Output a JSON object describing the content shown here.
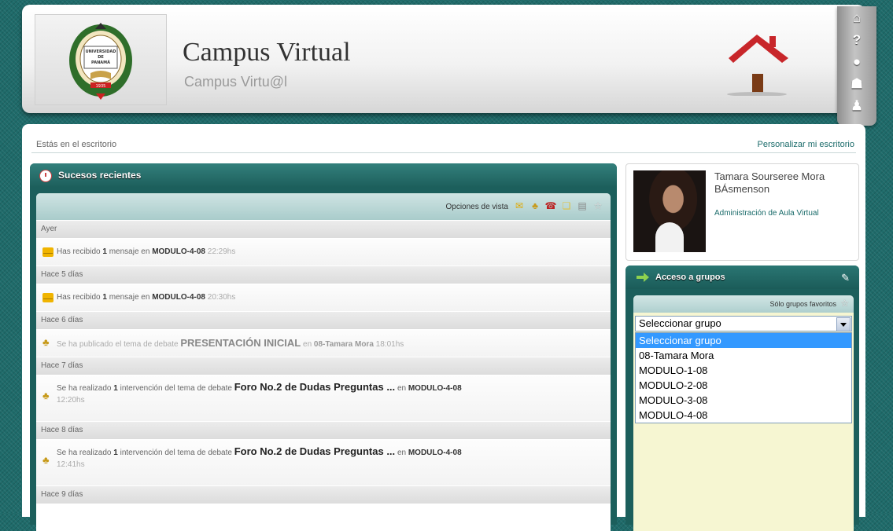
{
  "header": {
    "title": "Campus Virtual",
    "subtitle": "Campus Virtu@l",
    "logo_text": [
      "UNIVERSIDAD",
      "DE",
      "PANAMÁ",
      "1935"
    ]
  },
  "toolbar": {
    "icons": [
      "home-icon",
      "help-icon",
      "search-icon",
      "user-icon",
      "people-icon"
    ]
  },
  "breadcrumb": "Estás en el escritorio",
  "personalize_link": "Personalizar mi escritorio",
  "events": {
    "title": "Sucesos recientes",
    "view_options_label": "Opciones de vista",
    "days": [
      {
        "label": "Ayer",
        "items": [
          {
            "type": "message",
            "pre": "Has recibido",
            "count": "1",
            "mid": "mensaje en",
            "course": "MODULO-4-08",
            "time": "22:29hs"
          }
        ]
      },
      {
        "label": "Hace 5 días",
        "items": [
          {
            "type": "message",
            "pre": "Has recibido",
            "count": "1",
            "mid": "mensaje en",
            "course": "MODULO-4-08",
            "time": "20:30hs"
          }
        ]
      },
      {
        "label": "Hace 6 días",
        "items": [
          {
            "type": "forum",
            "pre": "Se ha publicado el tema de debate",
            "topic": "PRESENTACIÓN INICIAL",
            "mid": "en",
            "course": "08-Tamara Mora",
            "time": "18:01hs"
          }
        ]
      },
      {
        "label": "Hace 7 días",
        "items": [
          {
            "type": "forum",
            "pre": "Se ha realizado",
            "count": "1",
            "mid": "intervención del tema de debate",
            "topic": "Foro No.2 de Dudas Preguntas ...",
            "mid2": "en",
            "course": "MODULO-4-08",
            "time": "12:20hs"
          }
        ]
      },
      {
        "label": "Hace 8 días",
        "items": [
          {
            "type": "forum",
            "pre": "Se ha realizado",
            "count": "1",
            "mid": "intervención del tema de debate",
            "topic": "Foro No.2 de Dudas Preguntas ...",
            "mid2": "en",
            "course": "MODULO-4-08",
            "time": "12:41hs"
          }
        ]
      },
      {
        "label": "Hace 9 días",
        "items": []
      }
    ]
  },
  "profile": {
    "name": "Tamara Sourseree Mora BÁsmenson",
    "role": "Administración de Aula Virtual"
  },
  "groups": {
    "title": "Acceso a grupos",
    "favorites_label": "Sólo grupos favoritos",
    "select_value": "Seleccionar grupo",
    "options": [
      "Seleccionar grupo",
      "08-Tamara Mora",
      "MODULO-1-08",
      "MODULO-2-08",
      "MODULO-3-08",
      "MODULO-4-08"
    ],
    "selected_index": 0
  },
  "colors": {
    "background": "#1f6b6a",
    "panel_dark": "#1c5f5c",
    "link": "#1a6b6a",
    "highlight": "#3399ff"
  }
}
